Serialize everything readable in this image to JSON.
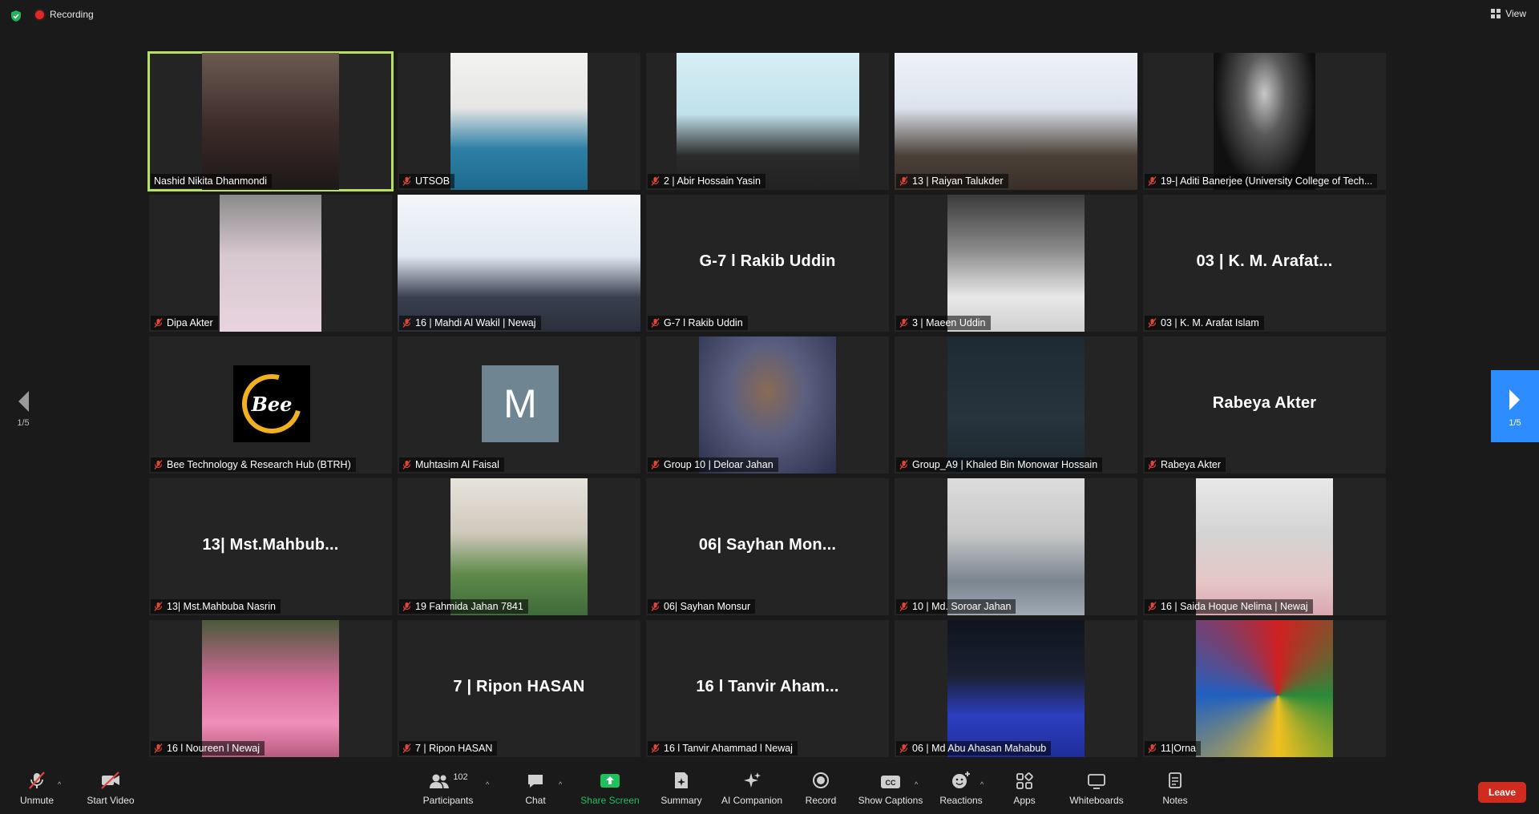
{
  "topbar": {
    "recording_label": "Recording",
    "view_label": "View"
  },
  "pager": {
    "left_page": "1/5",
    "right_page": "1/5"
  },
  "tiles": [
    {
      "label": "Nashid Nikita Dhanmondi",
      "kind": "photo",
      "active": true
    },
    {
      "label": "UTSOB",
      "kind": "photo"
    },
    {
      "label": "2 | Abir Hossain Yasin",
      "kind": "photo"
    },
    {
      "label": "13 | Raiyan Talukder",
      "kind": "photo"
    },
    {
      "label": "19-| Aditi Banerjee (University College of Tech...",
      "kind": "photo"
    },
    {
      "label": "Dipa Akter",
      "kind": "photo"
    },
    {
      "label": "16 | Mahdi Al Wakil | Newaj",
      "kind": "photo"
    },
    {
      "label": "G-7 l  Rakib Uddin",
      "kind": "name",
      "big": "G-7 l  Rakib Uddin"
    },
    {
      "label": "3 | Maeen Uddin",
      "kind": "photo"
    },
    {
      "label": "03 | K. M. Arafat Islam",
      "kind": "name",
      "big": "03 | K. M. Arafat..."
    },
    {
      "label": "Bee Technology & Research Hub (BTRH)",
      "kind": "logo",
      "logo_text": "Bee"
    },
    {
      "label": "Muhtasim Al Faisal",
      "kind": "avatar",
      "avatar_letter": "M"
    },
    {
      "label": "Group 10 | Deloar Jahan",
      "kind": "photo"
    },
    {
      "label": "Group_A9 | Khaled Bin Monowar Hossain",
      "kind": "photo"
    },
    {
      "label": "Rabeya Akter",
      "kind": "name",
      "big": "Rabeya Akter"
    },
    {
      "label": "13| Mst.Mahbuba Nasrin",
      "kind": "name",
      "big": "13| Mst.Mahbub..."
    },
    {
      "label": "19 Fahmida Jahan 7841",
      "kind": "photo"
    },
    {
      "label": "06| Sayhan Monsur",
      "kind": "name",
      "big": "06| Sayhan Mon..."
    },
    {
      "label": "10 | Md. Soroar Jahan",
      "kind": "photo"
    },
    {
      "label": "16 |  Saida Hoque Nelima | Newaj",
      "kind": "photo"
    },
    {
      "label": "16 l Noureen l Newaj",
      "kind": "photo"
    },
    {
      "label": "7 | Ripon HASAN",
      "kind": "name",
      "big": "7 | Ripon HASAN"
    },
    {
      "label": "16 l Tanvir Ahammad l Newaj",
      "kind": "name",
      "big": "16 l Tanvir Aham..."
    },
    {
      "label": "06 | Md Abu Ahasan Mahabub",
      "kind": "photo"
    },
    {
      "label": "11|Orna",
      "kind": "photo"
    }
  ],
  "toolbar": {
    "unmute": "Unmute",
    "start_video": "Start Video",
    "participants": "Participants",
    "participants_count": "102",
    "chat": "Chat",
    "share_screen": "Share Screen",
    "summary": "Summary",
    "ai_companion": "AI Companion",
    "record": "Record",
    "show_captions": "Show Captions",
    "reactions": "Reactions",
    "apps": "Apps",
    "whiteboards": "Whiteboards",
    "notes": "Notes",
    "leave": "Leave"
  },
  "colors": {
    "active_speaker_border": "#b7e160",
    "share_green": "#20c05c",
    "leave_red": "#cf2b1f",
    "pager_blue": "#2d8cff",
    "muted_red": "#e0453a"
  }
}
